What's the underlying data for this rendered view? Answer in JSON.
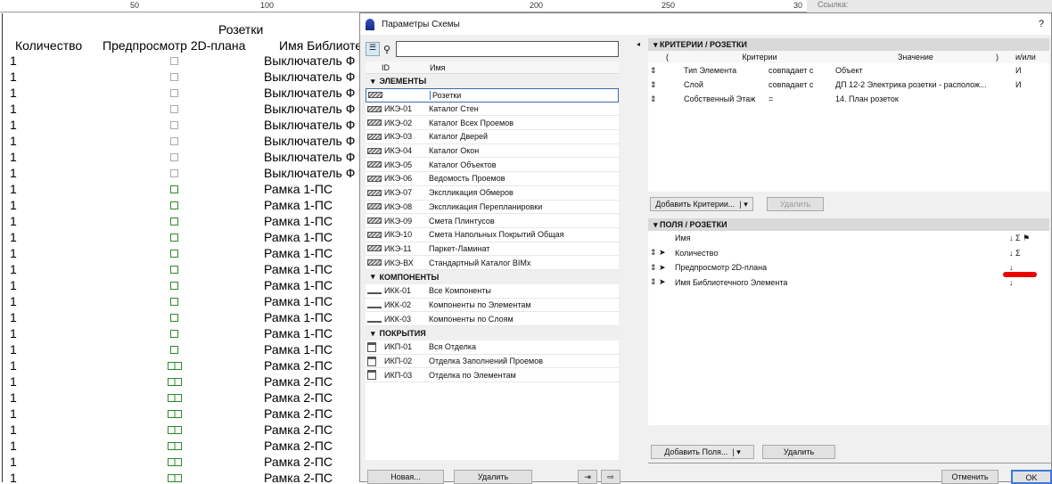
{
  "ruler": {
    "labels": [
      "50",
      "100",
      "200",
      "250",
      "30"
    ],
    "right_label": "Ссылка:"
  },
  "sheet": {
    "title": "Розетки",
    "headers": [
      "Количество",
      "Предпросмотр 2D-плана",
      "Имя Библиотечного Элемента"
    ],
    "rows": [
      {
        "q": "1",
        "name": "Выключатель Ф",
        "pv": "gray"
      },
      {
        "q": "1",
        "name": "Выключатель Ф",
        "pv": "gray"
      },
      {
        "q": "1",
        "name": "Выключатель Ф",
        "pv": "gray"
      },
      {
        "q": "1",
        "name": "Выключатель Ф",
        "pv": "gray"
      },
      {
        "q": "1",
        "name": "Выключатель Ф",
        "pv": "gray"
      },
      {
        "q": "1",
        "name": "Выключатель Ф",
        "pv": "gray"
      },
      {
        "q": "1",
        "name": "Выключатель Ф",
        "pv": "gray"
      },
      {
        "q": "1",
        "name": "Выключатель Ф",
        "pv": "gray"
      },
      {
        "q": "1",
        "name": "Рамка 1-ПС",
        "pv": "green"
      },
      {
        "q": "1",
        "name": "Рамка 1-ПС",
        "pv": "green"
      },
      {
        "q": "1",
        "name": "Рамка 1-ПС",
        "pv": "green"
      },
      {
        "q": "1",
        "name": "Рамка 1-ПС",
        "pv": "green"
      },
      {
        "q": "1",
        "name": "Рамка 1-ПС",
        "pv": "green"
      },
      {
        "q": "1",
        "name": "Рамка 1-ПС",
        "pv": "green"
      },
      {
        "q": "1",
        "name": "Рамка 1-ПС",
        "pv": "green"
      },
      {
        "q": "1",
        "name": "Рамка 1-ПС",
        "pv": "green"
      },
      {
        "q": "1",
        "name": "Рамка 1-ПС",
        "pv": "green"
      },
      {
        "q": "1",
        "name": "Рамка 1-ПС",
        "pv": "green"
      },
      {
        "q": "1",
        "name": "Рамка 1-ПС",
        "pv": "green"
      },
      {
        "q": "1",
        "name": "Рамка 2-ПС",
        "pv": "green2"
      },
      {
        "q": "1",
        "name": "Рамка 2-ПС",
        "pv": "green2"
      },
      {
        "q": "1",
        "name": "Рамка 2-ПС",
        "pv": "green2"
      },
      {
        "q": "1",
        "name": "Рамка 2-ПС",
        "pv": "green2"
      },
      {
        "q": "1",
        "name": "Рамка 2-ПС",
        "pv": "green2"
      },
      {
        "q": "1",
        "name": "Рамка 2-ПС",
        "pv": "green2"
      },
      {
        "q": "1",
        "name": "Рамка 2-ПС",
        "pv": "green2"
      },
      {
        "q": "1",
        "name": "Рамка 2-ПС",
        "pv": "green2"
      }
    ]
  },
  "dialog": {
    "title": "Параметры Схемы",
    "help": "?",
    "list": {
      "col_id": "ID",
      "col_name": "Имя",
      "search_value": "",
      "groups": [
        {
          "name": "ЭЛЕМЕНТЫ",
          "icon": "e",
          "items": [
            [
              "",
              "Розетки"
            ],
            [
              "ИКЭ-01",
              "Каталог Стен"
            ],
            [
              "ИКЭ-02",
              "Каталог Всех Проемов"
            ],
            [
              "ИКЭ-03",
              "Каталог Дверей"
            ],
            [
              "ИКЭ-04",
              "Каталог Окон"
            ],
            [
              "ИКЭ-05",
              "Каталог Объектов"
            ],
            [
              "ИКЭ-06",
              "Ведомость Проемов"
            ],
            [
              "ИКЭ-07",
              "Экспликация Обмеров"
            ],
            [
              "ИКЭ-08",
              "Экспликация Перепланировки"
            ],
            [
              "ИКЭ-09",
              "Смета Плинтусов"
            ],
            [
              "ИКЭ-10",
              "Смета Напольных Покрытий Общая"
            ],
            [
              "ИКЭ-11",
              "Паркет-Ламинат"
            ],
            [
              "ИКЭ-ВХ",
              "Стандартный Каталог BIMx"
            ]
          ]
        },
        {
          "name": "КОМПОНЕНТЫ",
          "icon": "c",
          "items": [
            [
              "ИКК-01",
              "Все Компоненты"
            ],
            [
              "ИКК-02",
              "Компоненты по Элементам"
            ],
            [
              "ИКК-03",
              "Компоненты по Слоям"
            ]
          ]
        },
        {
          "name": "ПОКРЫТИЯ",
          "icon": "p",
          "items": [
            [
              "ИКП-01",
              "Вся Отделка"
            ],
            [
              "ИКП-02",
              "Отделка Заполнений Проемов"
            ],
            [
              "ИКП-03",
              "Отделка по Элементам"
            ]
          ]
        }
      ]
    },
    "new_label": "Новая...",
    "delete_label": "Удалить",
    "criteria": {
      "title": "КРИТЕРИИ / РОЗЕТКИ",
      "headers": [
        "(",
        "Критерии",
        "Значение",
        ")",
        "и/или"
      ],
      "rows": [
        [
          "Тип Элемента",
          "совпадает с",
          "Объект",
          "И"
        ],
        [
          "Слой",
          "совпадает с",
          "ДП 12-2 Электрика розетки - располож...",
          "И"
        ],
        [
          "Собственный Этаж",
          "=",
          "14. План розеток",
          ""
        ]
      ],
      "add_label": "Добавить Критерии...",
      "delete_label": "Удалить"
    },
    "fields": {
      "title": "ПОЛЯ / РОЗЕТКИ",
      "header": "Имя",
      "header_icons": "↓ Σ ⚑",
      "rows": [
        [
          "Количество",
          "↓ Σ"
        ],
        [
          "Предпросмотр 2D-плана",
          "↓"
        ],
        [
          "Имя Библиотечного Элемента",
          "↓"
        ]
      ],
      "add_label": "Добавить Поля...",
      "delete_label": "Удалить"
    },
    "cancel_label": "Отменить",
    "ok_label": "OK"
  }
}
